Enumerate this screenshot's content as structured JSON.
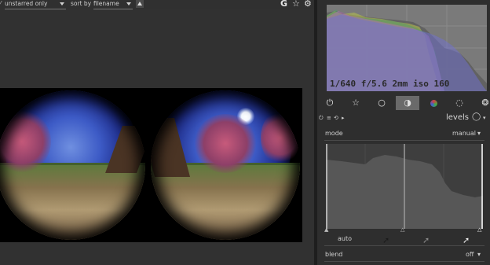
{
  "toolbar": {
    "filter_value": "unstarred only",
    "sort_label": "sort by",
    "sort_value": "filename",
    "group_label": "G",
    "icons": [
      "star-icon",
      "gear-icon",
      "sort-up-icon"
    ]
  },
  "histogram": {
    "exif_text": "1/640 f/5.6 2mm iso 160"
  },
  "modules": {
    "icons": [
      "power-icon",
      "star-icon",
      "circle-icon",
      "half-circle-icon",
      "color-circle-icon",
      "shape-icon",
      "palette-icon"
    ],
    "active_index": 3
  },
  "levels": {
    "title": "levels",
    "mode_label": "mode",
    "mode_value": "manual",
    "auto_label": "auto",
    "blend_label": "blend",
    "blend_value": "off",
    "markers": [
      0.0,
      0.5,
      1.0
    ]
  },
  "colors": {
    "accent_active": "#6a6a6a",
    "panel_bg": "#2e2e2e"
  }
}
